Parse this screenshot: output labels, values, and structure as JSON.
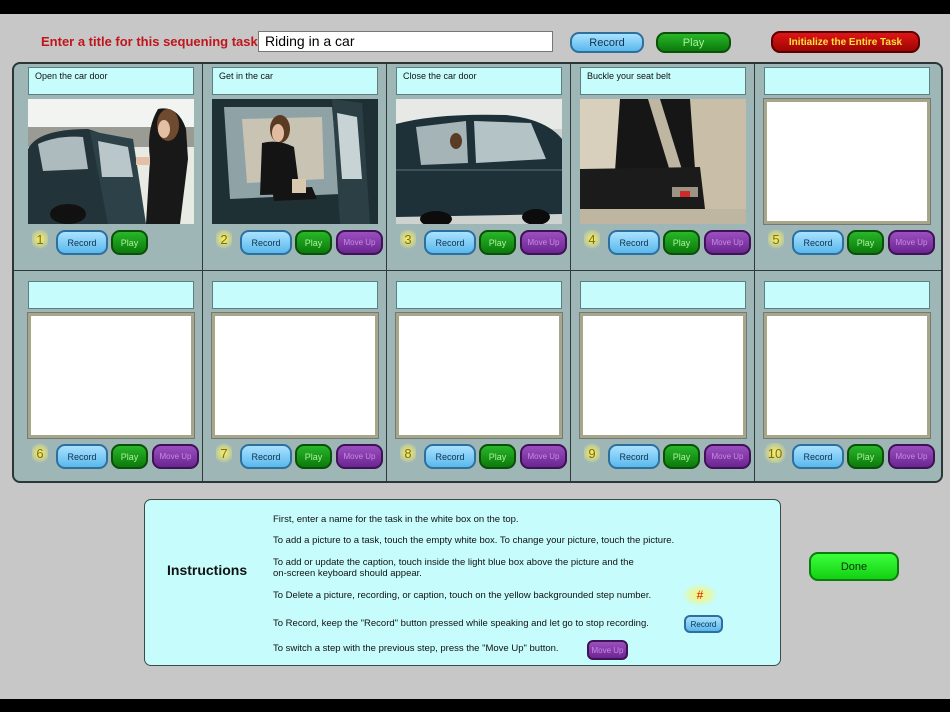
{
  "header": {
    "title_label": "Enter a title for this sequening task:",
    "title_value": "Riding in a car",
    "record_label": "Record",
    "play_label": "Play",
    "initialize_label": "Initialize the Entire Task"
  },
  "steps": [
    {
      "number": "1",
      "caption": "Open the car door",
      "has_photo": true
    },
    {
      "number": "2",
      "caption": "Get in the car",
      "has_photo": true
    },
    {
      "number": "3",
      "caption": "Close the car door",
      "has_photo": true
    },
    {
      "number": "4",
      "caption": "Buckle your seat belt",
      "has_photo": true
    },
    {
      "number": "5",
      "caption": "",
      "has_photo": false
    },
    {
      "number": "6",
      "caption": "",
      "has_photo": false
    },
    {
      "number": "7",
      "caption": "",
      "has_photo": false
    },
    {
      "number": "8",
      "caption": "",
      "has_photo": false
    },
    {
      "number": "9",
      "caption": "",
      "has_photo": false
    },
    {
      "number": "10",
      "caption": "",
      "has_photo": false
    }
  ],
  "step_buttons": {
    "record": "Record",
    "play": "Play",
    "move_up": "Move Up"
  },
  "instructions": {
    "title": "Instructions",
    "lines": [
      "First, enter a name for the task in the white box on the top.",
      "To add a picture to a task, touch the empty white box. To change your picture, touch the picture.",
      "To add or update the caption, touch inside the light blue box above the picture and the",
      "on-screen keyboard should appear.",
      "To Delete a picture, recording, or caption, touch on the yellow backgrounded step number.",
      "To Record, keep the \"Record\" button pressed while speaking and let go to stop recording.",
      "To switch a step with the previous step, press the \"Move Up\" button."
    ],
    "hash_sample": "#",
    "record_sample": "Record",
    "moveup_sample": "Move Up"
  },
  "done_label": "Done",
  "colors": {
    "title_label": "#c0151b",
    "caption_bg": "#c6fcfc",
    "grid_bg": "#9fb6b6",
    "record_blue": "#5ab8ec",
    "play_green": "#0b7a0b",
    "moveup_purple": "#6b2591",
    "initialize_red": "#c40a0a",
    "done_green": "#2ae82a"
  }
}
